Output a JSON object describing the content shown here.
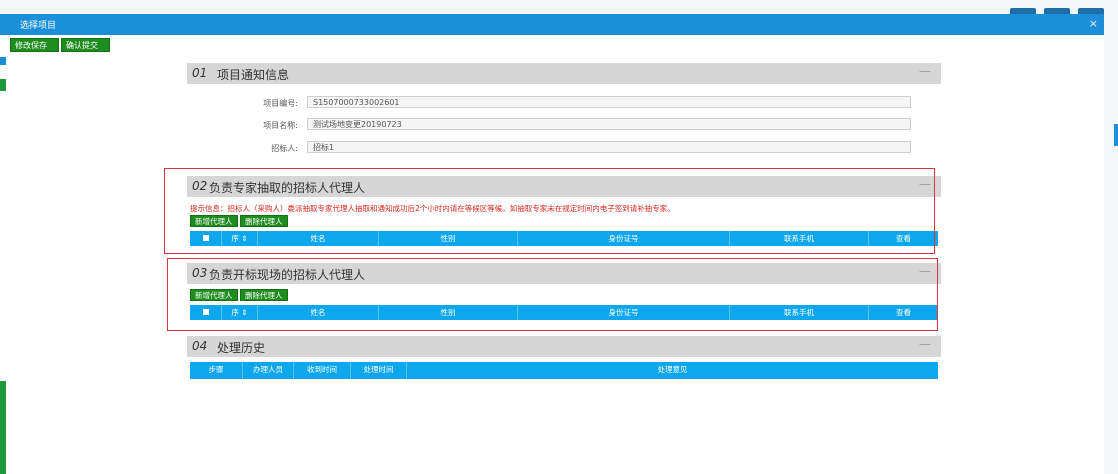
{
  "window": {
    "title": "选择项目",
    "close_icon": "×"
  },
  "toolbar": {
    "save_label": "修改保存",
    "submit_label": "确认提交"
  },
  "section1": {
    "number": "01",
    "title": "项目通知信息",
    "collapse": "—",
    "fields": [
      {
        "label": "项目编号:",
        "value": "S1507000733002601"
      },
      {
        "label": "项目名称:",
        "value": "测试场地变更20190723"
      },
      {
        "label": "招标人:",
        "value": "招标1"
      }
    ]
  },
  "section2": {
    "number": "02",
    "title": "负责专家抽取的招标人代理人",
    "collapse": "—",
    "notice": "提示信息：招标人（采购人）委派抽取专家代理人抽取和通知成功后2个小时内请在等候区等候。如抽取专家未在规定时间内电子签到请补抽专家。",
    "add_label": "新增代理人",
    "delete_label": "删除代理人",
    "columns": [
      "",
      "序 ⇕",
      "姓名",
      "性别",
      "身份证号",
      "联系手机",
      "查看"
    ]
  },
  "section3": {
    "number": "03",
    "title": "负责开标现场的招标人代理人",
    "collapse": "—",
    "add_label": "新增代理人",
    "delete_label": "删除代理人",
    "columns": [
      "",
      "序 ⇕",
      "姓名",
      "性别",
      "身份证号",
      "联系手机",
      "查看"
    ]
  },
  "section4": {
    "number": "04",
    "title": "处理历史",
    "collapse": "—",
    "columns": [
      "步骤",
      "办理人员",
      "收到时间",
      "处理时间",
      "处理意见"
    ]
  },
  "colors": {
    "titlebar": "#1c8fd9",
    "table_header": "#0ea7ee",
    "button_green": "#1f8c1f",
    "notice_red": "#d9261c",
    "highlight_box": "#d9363e"
  }
}
